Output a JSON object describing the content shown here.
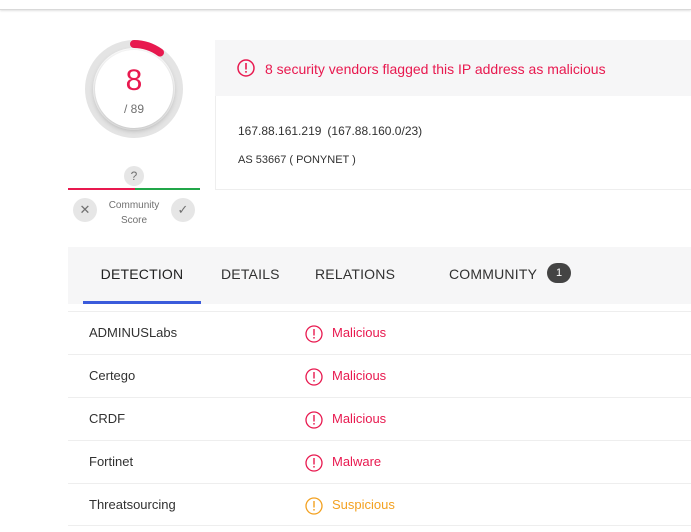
{
  "score": {
    "detections": "8",
    "total": "/ 89",
    "community_question": "?",
    "community_label": "Community Score"
  },
  "alert": {
    "text": "8 security vendors flagged this IP address as malicious",
    "icon": "exclamation-circle-icon",
    "color": "#e8194f"
  },
  "ip_info": {
    "ip": "167.88.161.219",
    "range": "(167.88.160.0/23)",
    "as": "AS 53667 ( PONYNET )"
  },
  "tabs": [
    {
      "label": "DETECTION",
      "active": true
    },
    {
      "label": "DETAILS"
    },
    {
      "label": "RELATIONS"
    },
    {
      "label": "COMMUNITY",
      "badge": "1"
    }
  ],
  "results": [
    {
      "vendor": "ADMINUSLabs",
      "verdict": "Malicious",
      "category": "malicious"
    },
    {
      "vendor": "Certego",
      "verdict": "Malicious",
      "category": "malicious"
    },
    {
      "vendor": "CRDF",
      "verdict": "Malicious",
      "category": "malicious"
    },
    {
      "vendor": "Fortinet",
      "verdict": "Malware",
      "category": "malicious"
    },
    {
      "vendor": "Threatsourcing",
      "verdict": "Suspicious",
      "category": "suspicious"
    }
  ],
  "colors": {
    "malicious": "#e8194f",
    "suspicious": "#f3a120",
    "harmless": "#21a649",
    "active_tab": "#3b5bdb"
  }
}
